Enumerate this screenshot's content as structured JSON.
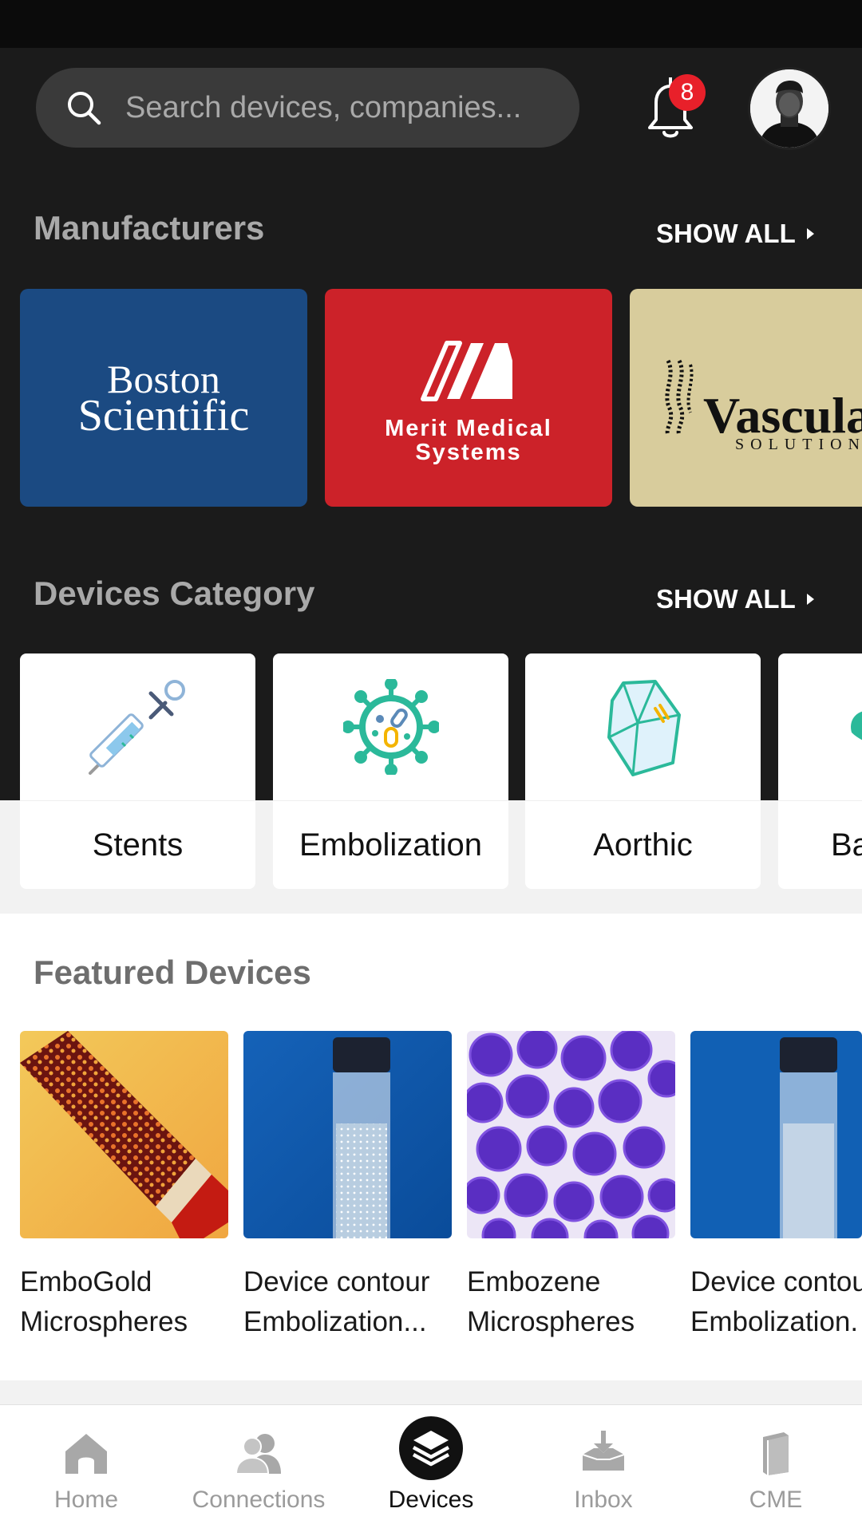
{
  "search": {
    "placeholder": "Search devices, companies..."
  },
  "notifications": {
    "count": "8"
  },
  "manufacturers": {
    "title": "Manufacturers",
    "show_all": "SHOW ALL",
    "items": [
      {
        "name_line1": "Boston",
        "name_line2": "Scientific",
        "color": "#1b4a82"
      },
      {
        "name_line1": "Merit Medical",
        "name_line2": "Systems",
        "color": "#cc2229"
      },
      {
        "name_line1": "Vascular",
        "name_line2": "SOLUTIONS",
        "color": "#d8cc9c"
      }
    ]
  },
  "categories": {
    "title": "Devices Category",
    "show_all": "SHOW ALL",
    "items": [
      {
        "label": "Stents",
        "icon": "syringe-icon"
      },
      {
        "label": "Embolization",
        "icon": "virus-icon"
      },
      {
        "label": "Aorthic",
        "icon": "crystal-icon"
      },
      {
        "label": "Ba",
        "icon": "leaf-icon"
      }
    ]
  },
  "featured": {
    "title": "Featured Devices",
    "items": [
      {
        "line1": "EmboGold",
        "line2": "Microspheres"
      },
      {
        "line1": "Device contour",
        "line2": "Embolization..."
      },
      {
        "line1": "Embozene",
        "line2": "Microspheres"
      },
      {
        "line1": "Device contou",
        "line2": "Embolization."
      }
    ]
  },
  "tabs": [
    {
      "label": "Home",
      "icon": "home-icon"
    },
    {
      "label": "Connections",
      "icon": "people-icon"
    },
    {
      "label": "Devices",
      "icon": "layers-icon",
      "active": true
    },
    {
      "label": "Inbox",
      "icon": "inbox-icon"
    },
    {
      "label": "CME",
      "icon": "book-icon"
    }
  ],
  "colors": {
    "accent_red": "#e8202a",
    "dark_bg": "#1b1b1b",
    "teal": "#2bb99a"
  }
}
